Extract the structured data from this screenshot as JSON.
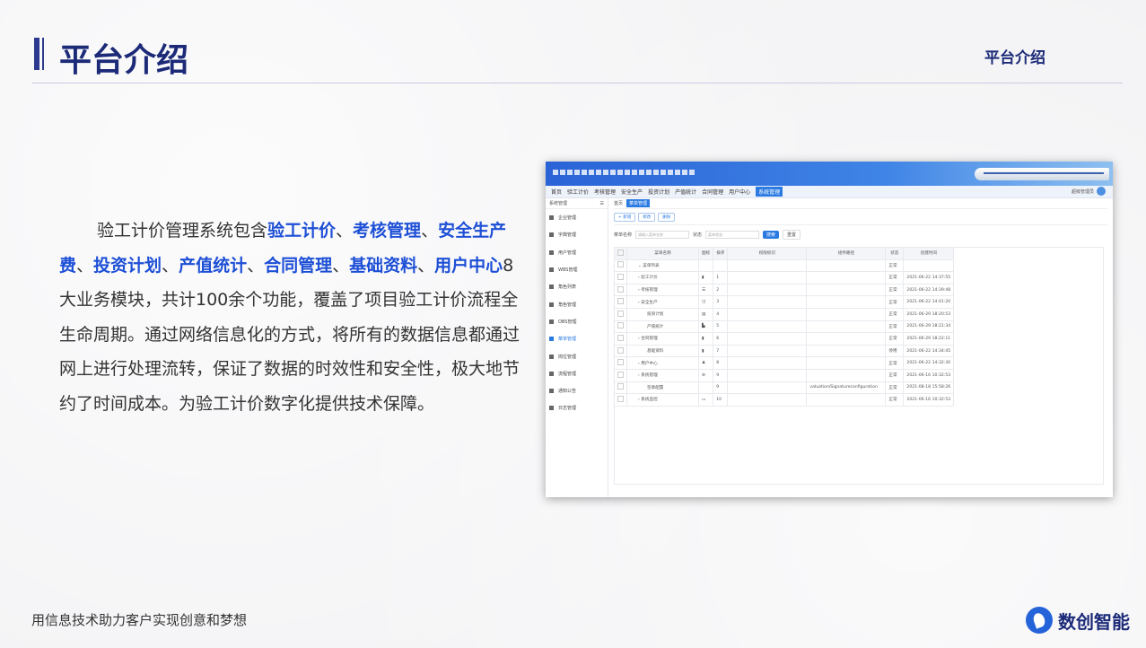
{
  "header": {
    "title": "平台介绍",
    "right_title": "平台介绍"
  },
  "description": {
    "segments": [
      {
        "text": "验工计价管理系统包含",
        "highlight": false
      },
      {
        "text": "验工计价",
        "highlight": true
      },
      {
        "text": "、",
        "highlight": false
      },
      {
        "text": "考核管理",
        "highlight": true
      },
      {
        "text": "、",
        "highlight": false
      },
      {
        "text": "安全生产费",
        "highlight": true
      },
      {
        "text": "、",
        "highlight": false
      },
      {
        "text": "投资计划",
        "highlight": true
      },
      {
        "text": "、",
        "highlight": false
      },
      {
        "text": "产值统计",
        "highlight": true
      },
      {
        "text": "、",
        "highlight": false
      },
      {
        "text": "合同管理",
        "highlight": true
      },
      {
        "text": "、",
        "highlight": false
      },
      {
        "text": "基础资料",
        "highlight": true
      },
      {
        "text": "、",
        "highlight": false
      },
      {
        "text": "用户中心",
        "highlight": true
      },
      {
        "text": "8大业务模块，共计100余个功能，覆盖了项目验工计价流程全生命周期。通过网络信息化的方式，将所有的数据信息都通过网上进行处理流转，保证了数据的时效性和安全性，极大地节约了时间成本。为验工计价数字化提供技术保障。",
        "highlight": false
      }
    ],
    "highlight_color": "#1d4fd6"
  },
  "footer": {
    "slogan": "用信息技术助力客户实现创意和梦想",
    "brand": "数创智能"
  },
  "screenshot": {
    "nav": [
      "首页",
      "验工计价",
      "考核管理",
      "安全生产",
      "投资计划",
      "产值统计",
      "合同管理",
      "用户中心",
      "系统管理"
    ],
    "nav_active": "系统管理",
    "user": "超级管理员",
    "sidebar_title": "系统管理",
    "sidebar": [
      "企业管理",
      "字典管理",
      "用户管理",
      "WBS管理",
      "角色列表",
      "角色管理",
      "OBS管理",
      "菜单管理",
      "岗位管理",
      "流程管理",
      "通知公告",
      "日志管理"
    ],
    "sidebar_active": "菜单管理",
    "tabs": [
      "首页",
      "菜单管理"
    ],
    "buttons": [
      "+ 新增",
      "修改",
      "删除"
    ],
    "filter": {
      "name_label": "菜单名称",
      "name_placeholder": "请输入菜单名称",
      "status_label": "状态",
      "status_placeholder": "菜单状态",
      "search": "搜索",
      "reset": "重置"
    },
    "columns": [
      "菜单名称",
      "图标",
      "排序",
      "权限标识",
      "组件路径",
      "状态",
      "创建时间"
    ],
    "rows": [
      {
        "name": "⌄ 菜单列表",
        "icon": "",
        "order": "",
        "perm": "",
        "path": "",
        "status": "正常",
        "time": ""
      },
      {
        "name": "› 验工计价",
        "icon": "▮",
        "order": "1",
        "perm": "",
        "path": "",
        "status": "正常",
        "time": "2021-06-22 14:37:55"
      },
      {
        "name": "› 考核管理",
        "icon": "☰",
        "order": "2",
        "perm": "",
        "path": "",
        "status": "正常",
        "time": "2021-06-22 14:39:48"
      },
      {
        "name": "› 安全生产",
        "icon": "◫",
        "order": "3",
        "perm": "",
        "path": "",
        "status": "正常",
        "time": "2021-06-22 14:41:20"
      },
      {
        "name": "投资计划",
        "icon": "▤",
        "order": "4",
        "perm": "",
        "path": "",
        "status": "正常",
        "time": "2021-06-29 18:20:53"
      },
      {
        "name": "产值统计",
        "icon": "▙",
        "order": "5",
        "perm": "",
        "path": "",
        "status": "正常",
        "time": "2021-06-29 18:21:34"
      },
      {
        "name": "› 合同管理",
        "icon": "▮",
        "order": "6",
        "perm": "",
        "path": "",
        "status": "正常",
        "time": "2021-06-29 18:22:11"
      },
      {
        "name": "基础资料",
        "icon": "▮",
        "order": "7",
        "perm": "",
        "path": "",
        "status": "停用",
        "time": "2021-06-22 14:34:45"
      },
      {
        "name": "› 用户中心",
        "icon": "♟",
        "order": "8",
        "perm": "",
        "path": "",
        "status": "正常",
        "time": "2021-06-22 14:32:30"
      },
      {
        "name": "› 系统管理",
        "icon": "⚙",
        "order": "9",
        "perm": "",
        "path": "",
        "status": "正常",
        "time": "2021-06-16 10:32:53"
      },
      {
        "name": "签章配置",
        "icon": "",
        "order": "9",
        "perm": "",
        "path": "valuation/Signatureconfiguration",
        "status": "正常",
        "time": "2021-08-18 15:58:26"
      },
      {
        "name": "› 系统监控",
        "icon": "▭",
        "order": "10",
        "perm": "",
        "path": "",
        "status": "正常",
        "time": "2021-06-16 10:32:53"
      }
    ]
  }
}
